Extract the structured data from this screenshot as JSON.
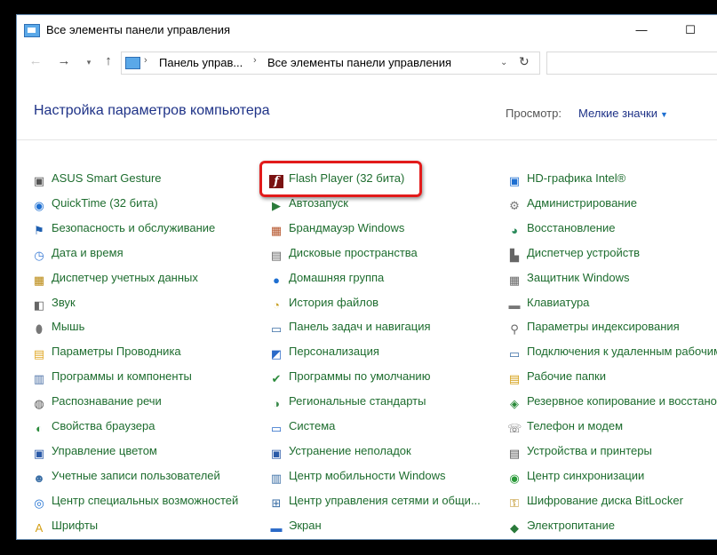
{
  "window": {
    "title": "Все элементы панели управления",
    "minimize_glyph": "—",
    "maximize_glyph": "☐"
  },
  "address": {
    "back_glyph": "←",
    "forward_glyph": "→",
    "recent_glyph": "▾",
    "up_glyph": "↑",
    "segments": [
      "Панель управ...",
      "Все элементы панели управления"
    ],
    "separator_glyph": "›",
    "dropdown_glyph": "⌄",
    "refresh_glyph": "↻"
  },
  "header": {
    "title": "Настройка параметров компьютера",
    "view_label": "Просмотр:",
    "view_value": "Мелкие значки",
    "view_caret": "▼"
  },
  "colors": {
    "item_text": "#1e6d2f",
    "title_text": "#1e3287",
    "highlight_border": "#e21b1b"
  },
  "columns": [
    {
      "items": [
        {
          "label": "ASUS Smart Gesture",
          "icon": "touchpad-icon",
          "glyph": "▣",
          "color": "#555"
        },
        {
          "label": "QuickTime (32 бита)",
          "icon": "quicktime-icon",
          "glyph": "◉",
          "color": "#1e6fd1"
        },
        {
          "label": "Безопасность и обслуживание",
          "icon": "flag-icon",
          "glyph": "⚑",
          "color": "#1e5fb0"
        },
        {
          "label": "Дата и время",
          "icon": "clock-icon",
          "glyph": "◷",
          "color": "#3a7bd5"
        },
        {
          "label": "Диспетчер учетных данных",
          "icon": "vault-icon",
          "glyph": "▦",
          "color": "#b8860b"
        },
        {
          "label": "Звук",
          "icon": "speaker-icon",
          "glyph": "◧",
          "color": "#666"
        },
        {
          "label": "Мышь",
          "icon": "mouse-icon",
          "glyph": "⬮",
          "color": "#777"
        },
        {
          "label": "Параметры Проводника",
          "icon": "folder-options-icon",
          "glyph": "▤",
          "color": "#e0a92a"
        },
        {
          "label": "Программы и компоненты",
          "icon": "programs-icon",
          "glyph": "▥",
          "color": "#4a6fa5"
        },
        {
          "label": "Распознавание речи",
          "icon": "microphone-icon",
          "glyph": "◍",
          "color": "#555"
        },
        {
          "label": "Свойства браузера",
          "icon": "internet-options-icon",
          "glyph": "◐",
          "color": "#2a8a3a"
        },
        {
          "label": "Управление цветом",
          "icon": "color-management-icon",
          "glyph": "▣",
          "color": "#2a5aa8"
        },
        {
          "label": "Учетные записи пользователей",
          "icon": "users-icon",
          "glyph": "☻",
          "color": "#3a6ea5"
        },
        {
          "label": "Центр специальных возможностей",
          "icon": "accessibility-icon",
          "glyph": "◎",
          "color": "#1e6fd1"
        },
        {
          "label": "Шрифты",
          "icon": "fonts-icon",
          "glyph": "A",
          "color": "#d4a017"
        }
      ]
    },
    {
      "items": [
        {
          "label": "Flash Player (32 бита)",
          "icon": "flash-player-icon",
          "glyph": "f",
          "color": "#fff"
        },
        {
          "label": "Автозапуск",
          "icon": "autoplay-icon",
          "glyph": "▶",
          "color": "#2a7a3a"
        },
        {
          "label": "Брандмауэр Windows",
          "icon": "firewall-icon",
          "glyph": "▦",
          "color": "#b5542a"
        },
        {
          "label": "Дисковые пространства",
          "icon": "storage-spaces-icon",
          "glyph": "▤",
          "color": "#666"
        },
        {
          "label": "Домашняя группа",
          "icon": "homegroup-icon",
          "glyph": "●",
          "color": "#1e6fd1"
        },
        {
          "label": "История файлов",
          "icon": "file-history-icon",
          "glyph": "◔",
          "color": "#c9a227"
        },
        {
          "label": "Панель задач и навигация",
          "icon": "taskbar-icon",
          "glyph": "▭",
          "color": "#3a6ea5"
        },
        {
          "label": "Персонализация",
          "icon": "personalization-icon",
          "glyph": "◩",
          "color": "#2a6ac8"
        },
        {
          "label": "Программы по умолчанию",
          "icon": "default-programs-icon",
          "glyph": "✔",
          "color": "#2a8a3a"
        },
        {
          "label": "Региональные стандарты",
          "icon": "region-icon",
          "glyph": "◑",
          "color": "#3a8a4a"
        },
        {
          "label": "Система",
          "icon": "system-icon",
          "glyph": "▭",
          "color": "#2a6ac8"
        },
        {
          "label": "Устранение неполадок",
          "icon": "troubleshooting-icon",
          "glyph": "▣",
          "color": "#2a5aa8"
        },
        {
          "label": "Центр мобильности Windows",
          "icon": "mobility-center-icon",
          "glyph": "▥",
          "color": "#3a6ea5"
        },
        {
          "label": "Центр управления сетями и общи...",
          "icon": "network-icon",
          "glyph": "⊞",
          "color": "#3a6ea5"
        },
        {
          "label": "Экран",
          "icon": "display-icon",
          "glyph": "▬",
          "color": "#2a6ac8"
        }
      ]
    },
    {
      "items": [
        {
          "label": "HD-графика Intel®",
          "icon": "intel-graphics-icon",
          "glyph": "▣",
          "color": "#1e6fd1"
        },
        {
          "label": "Администрирование",
          "icon": "admin-tools-icon",
          "glyph": "⚙",
          "color": "#777"
        },
        {
          "label": "Восстановление",
          "icon": "recovery-icon",
          "glyph": "◕",
          "color": "#2a8a5a"
        },
        {
          "label": "Диспетчер устройств",
          "icon": "device-manager-icon",
          "glyph": "▙",
          "color": "#666"
        },
        {
          "label": "Защитник Windows",
          "icon": "defender-icon",
          "glyph": "▦",
          "color": "#666"
        },
        {
          "label": "Клавиатура",
          "icon": "keyboard-icon",
          "glyph": "▬",
          "color": "#777"
        },
        {
          "label": "Параметры индексирования",
          "icon": "indexing-icon",
          "glyph": "⚲",
          "color": "#666"
        },
        {
          "label": "Подключения к удаленным рабочим столам",
          "icon": "remote-desktop-icon",
          "glyph": "▭",
          "color": "#3a6ea5"
        },
        {
          "label": "Рабочие папки",
          "icon": "work-folders-icon",
          "glyph": "▤",
          "color": "#d4a017"
        },
        {
          "label": "Резервное копирование и восстановление",
          "icon": "backup-icon",
          "glyph": "◈",
          "color": "#2a8a3a"
        },
        {
          "label": "Телефон и модем",
          "icon": "phone-modem-icon",
          "glyph": "☏",
          "color": "#666"
        },
        {
          "label": "Устройства и принтеры",
          "icon": "devices-printers-icon",
          "glyph": "▤",
          "color": "#555"
        },
        {
          "label": "Центр синхронизации",
          "icon": "sync-center-icon",
          "glyph": "◉",
          "color": "#2a9a3a"
        },
        {
          "label": "Шифрование диска BitLocker",
          "icon": "bitlocker-icon",
          "glyph": "⚿",
          "color": "#b8860b"
        },
        {
          "label": "Электропитание",
          "icon": "power-options-icon",
          "glyph": "◆",
          "color": "#2a7a3a"
        }
      ]
    }
  ]
}
